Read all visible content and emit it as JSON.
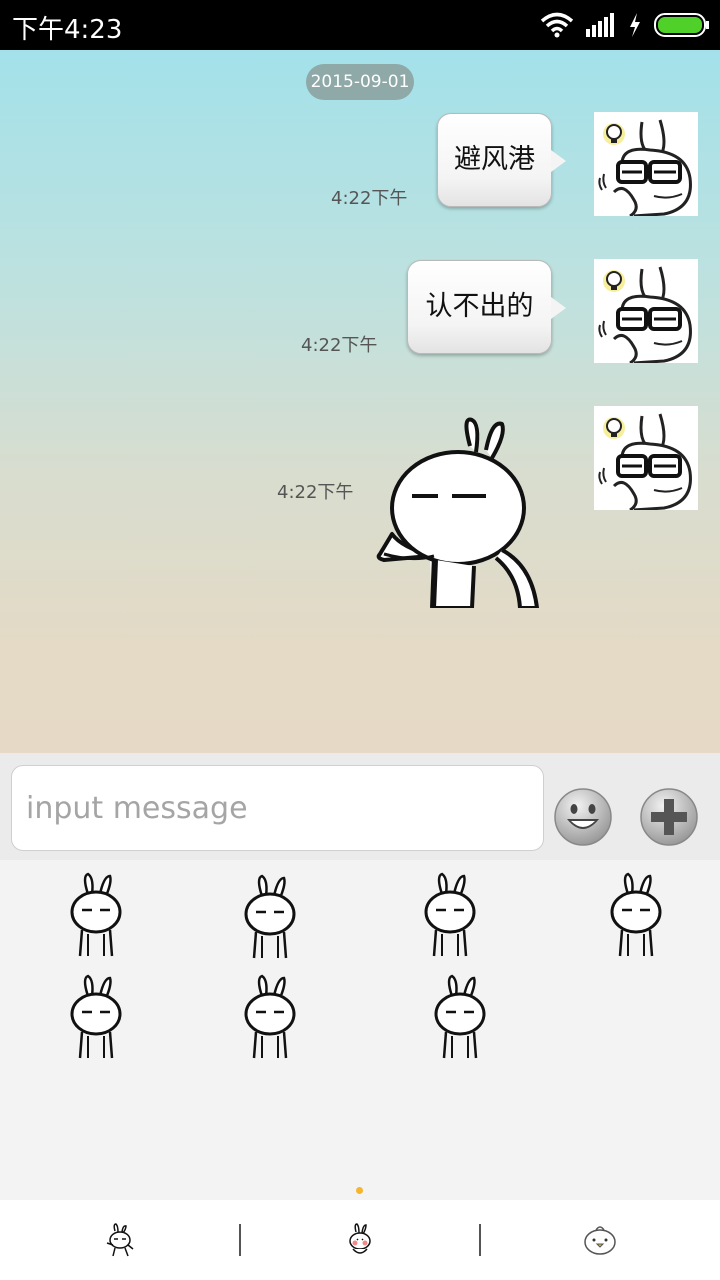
{
  "status_bar": {
    "time": "下午4:23",
    "icons": [
      "wifi-icon",
      "signal-icon",
      "charging-icon",
      "battery-icon"
    ],
    "battery_color": "#4fd12a"
  },
  "chat": {
    "date_label": "2015-09-01",
    "messages": [
      {
        "type": "text",
        "text": "避风港",
        "time": "4:22下午",
        "avatar": "rabbit-glasses-avatar"
      },
      {
        "type": "text",
        "text": "认不出的",
        "time": "4:22下午",
        "avatar": "rabbit-glasses-avatar"
      },
      {
        "type": "sticker",
        "sticker": "rabbit-pointing-sticker",
        "time": "4:22下午",
        "avatar": "rabbit-glasses-avatar"
      }
    ]
  },
  "input": {
    "placeholder": "input message",
    "value": "",
    "emoji_button": "smiley-icon",
    "more_button": "plus-icon"
  },
  "sticker_panel": {
    "stickers": [
      "rabbit-crying-sticker",
      "rabbit-lying-sticker",
      "rabbit-whistle-sticker",
      "rabbit-standing-sticker",
      "rabbit-bye-sticker",
      "rabbit-sparkle-sticker",
      "rabbit-thinking-sticker"
    ],
    "page_indicator_color": "#f7b52c"
  },
  "tabs": [
    "rabbit-tab-icon",
    "rabbit-blush-tab-icon",
    "chick-tab-icon"
  ]
}
